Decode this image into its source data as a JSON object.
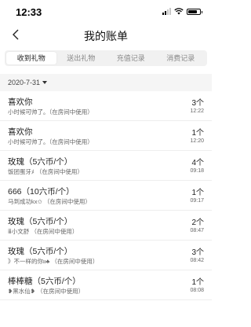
{
  "status_bar": {
    "time": "12:33"
  },
  "nav": {
    "title": "我的账单"
  },
  "tabs": [
    {
      "label": "收到礼物",
      "active": true
    },
    {
      "label": "送出礼物",
      "active": false
    },
    {
      "label": "充值记录",
      "active": false
    },
    {
      "label": "消费记录",
      "active": false
    }
  ],
  "date_filter": {
    "label": "2020-7-31"
  },
  "records": [
    {
      "title": "喜欢你",
      "sub": "小时候可帅了。（在房间中使用）",
      "qty": "3个",
      "time": "12:22"
    },
    {
      "title": "喜欢你",
      "sub": "小时候可帅了。（在房间中使用）",
      "qty": "1个",
      "time": "12:20"
    },
    {
      "title": "玫瑰（5六币/个）",
      "sub": "饭团蛋牙ﾒ  （在房间中使用）",
      "qty": "4个",
      "time": "09:18"
    },
    {
      "title": "666（10六币/个）",
      "sub": "马到成功kx✩  （在房间中使用）",
      "qty": "1个",
      "time": "09:17"
    },
    {
      "title": "玫瑰（5六币/个）",
      "sub": "ⅲ小文舒  （在房间中使用）",
      "qty": "2个",
      "time": "08:47"
    },
    {
      "title": "玫瑰（5六币/个）",
      "sub": "》不一样的你ιι♣  （在房间中使用）",
      "qty": "3个",
      "time": "08:42"
    },
    {
      "title": "棒棒糖（5六币/个）",
      "sub": "❥黑水仙❥  （在房间中使用）",
      "qty": "1个",
      "time": "08:08"
    }
  ]
}
